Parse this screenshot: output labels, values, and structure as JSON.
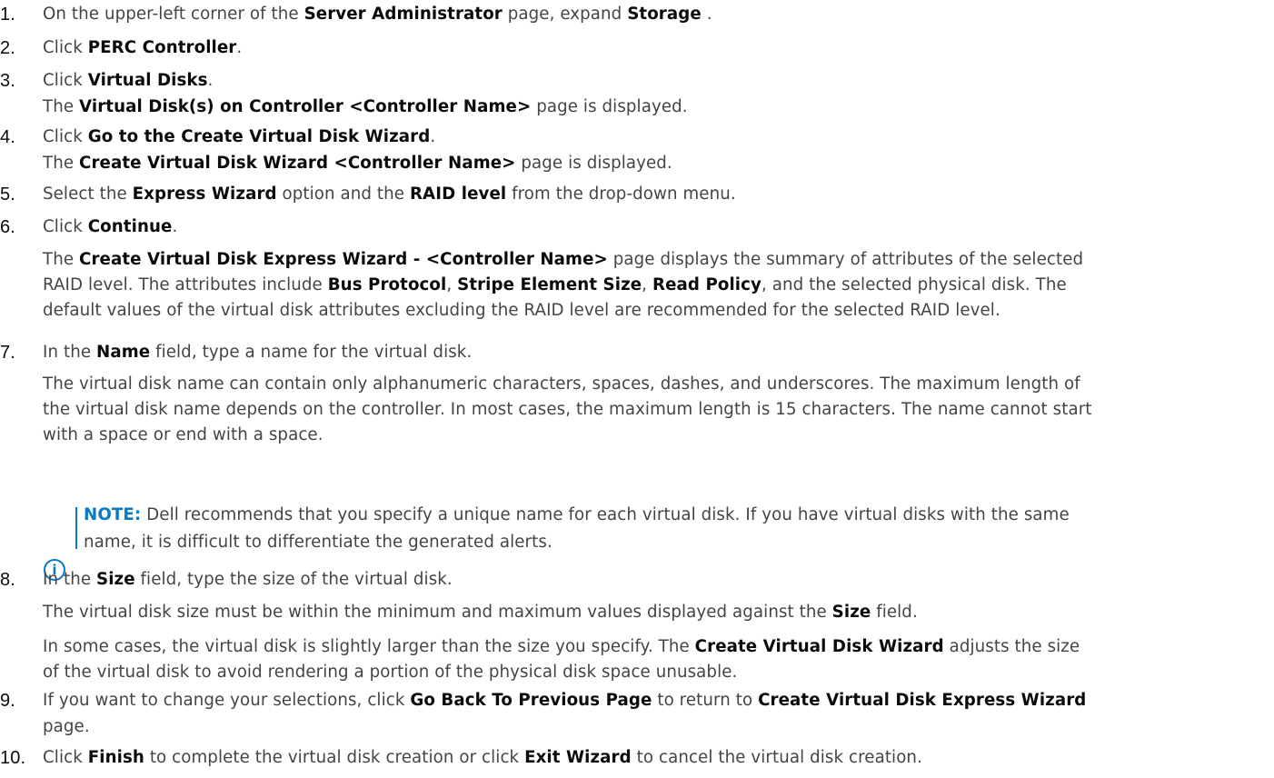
{
  "steps": [
    {
      "n": "1.",
      "parts": [
        "On the upper-left corner of the ",
        "Server Administrator",
        " page, expand ",
        "Storage",
        " ."
      ]
    },
    {
      "n": "2.",
      "parts": [
        "Click ",
        "PERC Controller",
        "."
      ]
    },
    {
      "n": "3.",
      "parts": [
        "Click ",
        "Virtual Disks",
        "."
      ],
      "sub": [
        "The ",
        "Virtual Disk(s) on Controller <Controller Name>",
        " page is displayed."
      ]
    },
    {
      "n": "4.",
      "parts": [
        "Click ",
        "Go to the Create Virtual Disk Wizard",
        "."
      ],
      "sub": [
        "The ",
        "Create Virtual Disk Wizard <Controller Name>",
        " page is displayed."
      ]
    },
    {
      "n": "5.",
      "parts": [
        "Select the ",
        "Express Wizard",
        " option and the ",
        "RAID level",
        " from the drop-down menu."
      ]
    },
    {
      "n": "6.",
      "parts": [
        "Click ",
        "Continue",
        "."
      ]
    },
    {
      "n": "7.",
      "parts": [
        "In the ",
        "Name",
        " field, type a name for the virtual disk."
      ]
    },
    {
      "n": "8.",
      "parts": [
        "In the ",
        "Size",
        " field, type the size of the virtual disk."
      ]
    },
    {
      "n": "9.",
      "parts": [
        "If you want to change your selections, click ",
        "Go Back To Previous Page",
        " to return to ",
        "Create Virtual Disk Express Wizard"
      ]
    },
    {
      "n": "10.",
      "parts": [
        "Click ",
        "Finish",
        " to complete the virtual disk creation or click ",
        "Exit Wizard",
        " to cancel the virtual disk creation."
      ]
    }
  ],
  "step6_para": {
    "l1": [
      "The ",
      "Create Virtual Disk Express Wizard - <Controller Name>",
      " page displays the summary of attributes of the selected"
    ],
    "l2": [
      "RAID level. The attributes include ",
      "Bus Protocol",
      ", ",
      "Stripe Element Size",
      ", ",
      "Read Policy",
      ", and the selected physical disk. The"
    ],
    "l3": "default values of the virtual disk attributes excluding the RAID level are recommended for the selected RAID level."
  },
  "step7_para": {
    "l1": "The virtual disk name can contain only alphanumeric characters, spaces, dashes, and underscores. The maximum length of",
    "l2": "the virtual disk name depends on the controller. In most cases, the maximum length is 15 characters. The name cannot start",
    "l3": "with a space or end with a space."
  },
  "note": {
    "icon": "i",
    "label": "NOTE:",
    "l1": " Dell recommends that you specify a unique name for each virtual disk. If you have virtual disks with the same",
    "l2": "name, it is difficult to differentiate the generated alerts."
  },
  "step8_para1": [
    "The virtual disk size must be within the minimum and maximum values displayed against the ",
    "Size",
    " field."
  ],
  "step8_para2": {
    "l1": [
      "In some cases, the virtual disk is slightly larger than the size you specify. The ",
      "Create Virtual Disk Wizard",
      " adjusts the size"
    ],
    "l2": "of the virtual disk to avoid rendering a portion of the physical disk space unusable."
  },
  "step9_tail": "page.",
  "colors": {
    "accent": "#0a7ac2",
    "text": "#444444",
    "bold": "#0b0b0b"
  }
}
